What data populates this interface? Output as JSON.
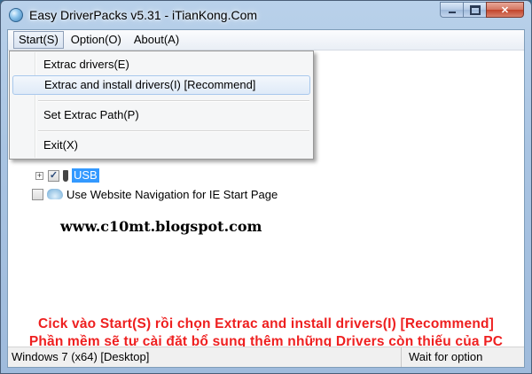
{
  "window": {
    "title": "Easy DriverPacks v5.31 - iTianKong.Com"
  },
  "menubar": {
    "items": [
      {
        "label": "Start(S)"
      },
      {
        "label": "Option(O)"
      },
      {
        "label": "About(A)"
      }
    ]
  },
  "start_menu": {
    "items": [
      {
        "label": "Extrac drivers(E)"
      },
      {
        "label": "Extrac and install drivers(I) [Recommend]"
      },
      {
        "label": "Set Extrac Path(P)"
      },
      {
        "label": "Exit(X)"
      }
    ]
  },
  "tree": {
    "usb_label": "USB",
    "usb_expander": "+",
    "usb_checked": "✓",
    "website_nav_label": "Use Website Navigation for IE Start Page"
  },
  "watermark": "www.c10mt.blogspot.com",
  "notice": {
    "line1": "Cick vào Start(S) rồi chọn Extrac and install drivers(I) [Recommend]",
    "line2": "Phần mềm sẽ tự cài đặt bổ sung thêm những Drivers còn thiếu của PC"
  },
  "statusbar": {
    "left": "Windows 7 (x64) [Desktop]",
    "right": "Wait for option"
  },
  "caption": {
    "close_glyph": "✕"
  }
}
